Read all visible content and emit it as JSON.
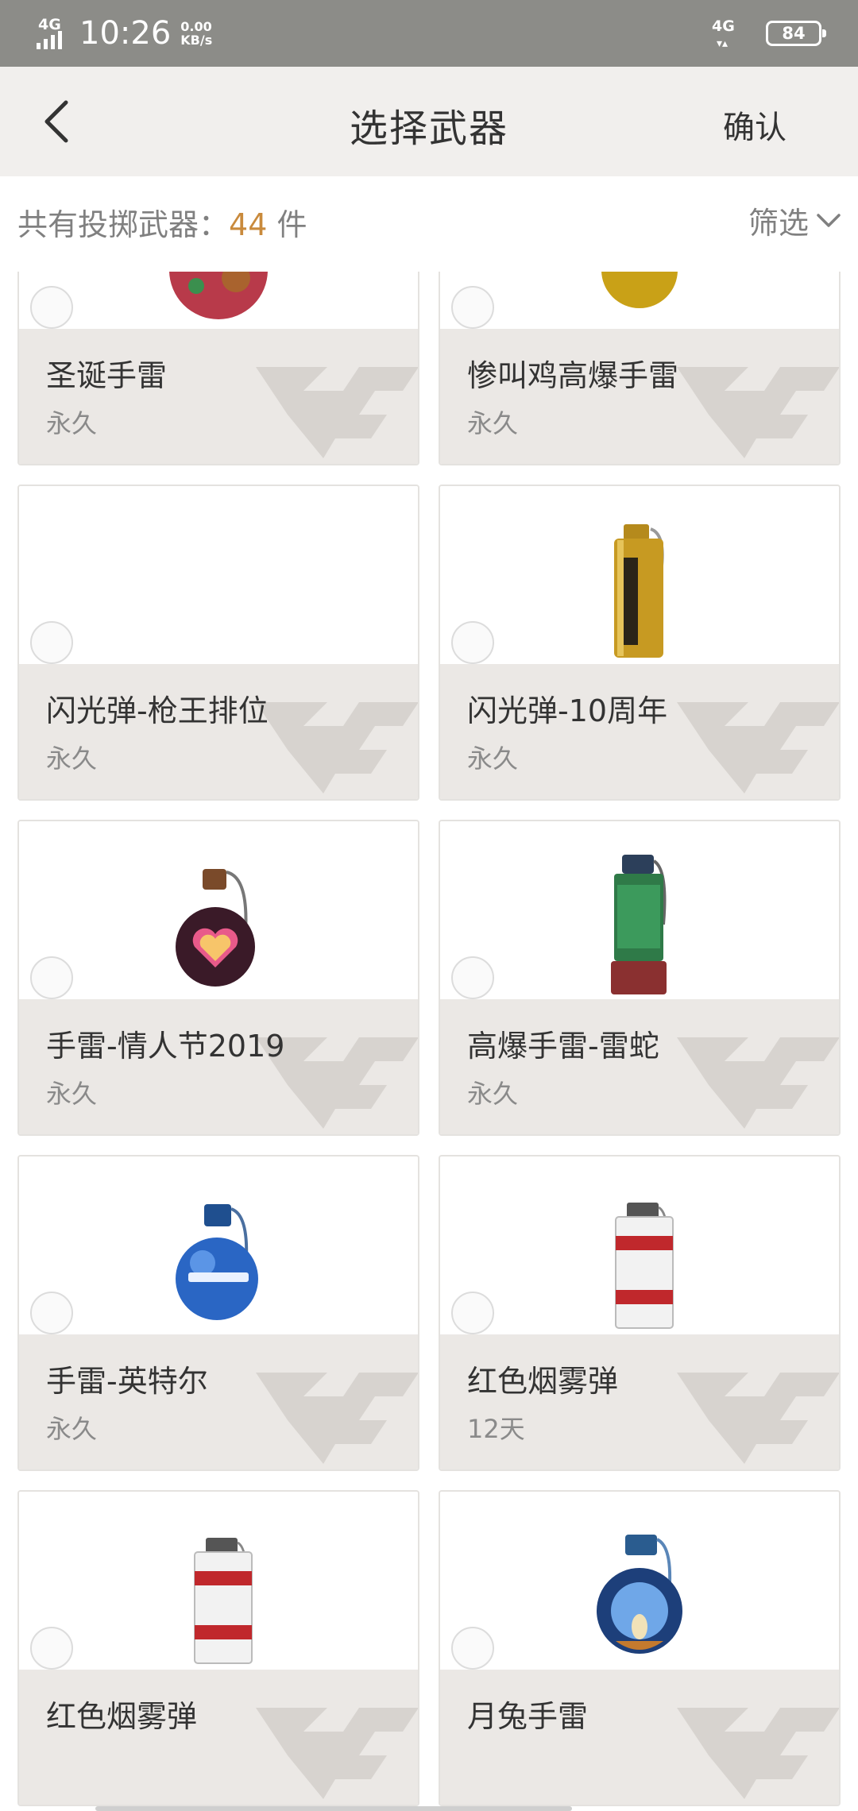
{
  "status_bar": {
    "network_left": "4G",
    "time": "10:26",
    "speed_value": "0.00",
    "speed_unit": "KB/s",
    "network_right": "4G",
    "battery": "84"
  },
  "header": {
    "title": "选择武器",
    "confirm_label": "确认",
    "back_icon": "chevron-left-icon"
  },
  "summary": {
    "count_prefix": "共有投掷武器：",
    "count_value": "44",
    "count_suffix": " 件",
    "filter_label": "筛选",
    "filter_icon": "chevron-down-icon"
  },
  "items": [
    {
      "name": "圣诞手雷",
      "duration": "永久",
      "icon": "christmas-grenade-icon"
    },
    {
      "name": "惨叫鸡高爆手雷",
      "duration": "永久",
      "icon": "gold-grenade-icon"
    },
    {
      "name": "闪光弹-枪王排位",
      "duration": "永久",
      "icon": ""
    },
    {
      "name": "闪光弹-10周年",
      "duration": "永久",
      "icon": "gold-flashbang-icon"
    },
    {
      "name": "手雷-情人节2019",
      "duration": "永久",
      "icon": "heart-grenade-icon"
    },
    {
      "name": "高爆手雷-雷蛇",
      "duration": "永久",
      "icon": "green-grenade-icon"
    },
    {
      "name": "手雷-英特尔",
      "duration": "永久",
      "icon": "blue-grenade-icon"
    },
    {
      "name": "红色烟雾弹",
      "duration": "12天",
      "icon": "smoke-grenade-icon"
    },
    {
      "name": "红色烟雾弹",
      "duration": "",
      "icon": "smoke-grenade-icon"
    },
    {
      "name": "月兔手雷",
      "duration": "",
      "icon": "moon-rabbit-grenade-icon"
    }
  ],
  "colors": {
    "status_bar": "#8c8c88",
    "title_bar": "#f1efed",
    "accent_count": "#c98a3c",
    "card_footer": "#ebe8e5"
  }
}
